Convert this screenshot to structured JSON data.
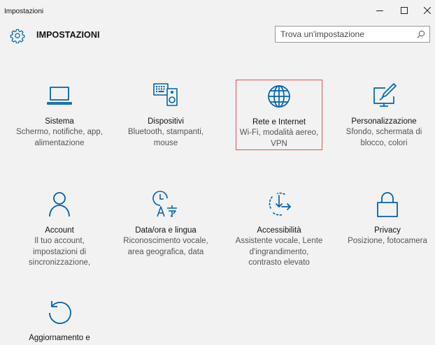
{
  "window": {
    "title": "Impostazioni",
    "controls": {
      "minimize_icon": "minimize-icon",
      "maximize_icon": "maximize-icon",
      "close_icon": "close-icon"
    }
  },
  "header": {
    "title": "IMPOSTAZIONI",
    "icon": "gear-icon"
  },
  "search": {
    "placeholder": "Trova un'impostazione",
    "value": "",
    "icon": "search-icon"
  },
  "colors": {
    "accent": "#0063b1",
    "selection_border": "#e5514e",
    "background": "#f2f2f2"
  },
  "categories": [
    {
      "id": "sistema",
      "label": "Sistema",
      "description": [
        "Schermo, notifiche, app,",
        "alimentazione"
      ],
      "icon": "laptop-icon",
      "selected": false
    },
    {
      "id": "dispositivi",
      "label": "Dispositivi",
      "description": [
        "Bluetooth, stampanti,",
        "mouse"
      ],
      "icon": "devices-icon",
      "selected": false
    },
    {
      "id": "rete",
      "label": "Rete e Internet",
      "description": [
        "Wi-Fi, modalità aereo,",
        "VPN"
      ],
      "icon": "globe-icon",
      "selected": true
    },
    {
      "id": "personalizzazione",
      "label": "Personalizzazione",
      "description": [
        "Sfondo, schermata di",
        "blocco, colori"
      ],
      "icon": "personalization-icon",
      "selected": false
    },
    {
      "id": "account",
      "label": "Account",
      "description": [
        "Il tuo account,",
        "impostazioni di",
        "sincronizzazione,"
      ],
      "icon": "person-icon",
      "selected": false
    },
    {
      "id": "data-ora",
      "label": "Data/ora e lingua",
      "description": [
        "Riconoscimento vocale,",
        "area geografica, data"
      ],
      "icon": "time-language-icon",
      "selected": false
    },
    {
      "id": "accessibilita",
      "label": "Accessibilità",
      "description": [
        "Assistente vocale, Lente",
        "d'ingrandimento,",
        "contrasto elevato"
      ],
      "icon": "ease-of-access-icon",
      "selected": false
    },
    {
      "id": "privacy",
      "label": "Privacy",
      "description": [
        "Posizione, fotocamera"
      ],
      "icon": "lock-icon",
      "selected": false
    },
    {
      "id": "aggiornamento",
      "label": "Aggiornamento e",
      "description": [],
      "icon": "update-icon",
      "selected": false
    }
  ]
}
